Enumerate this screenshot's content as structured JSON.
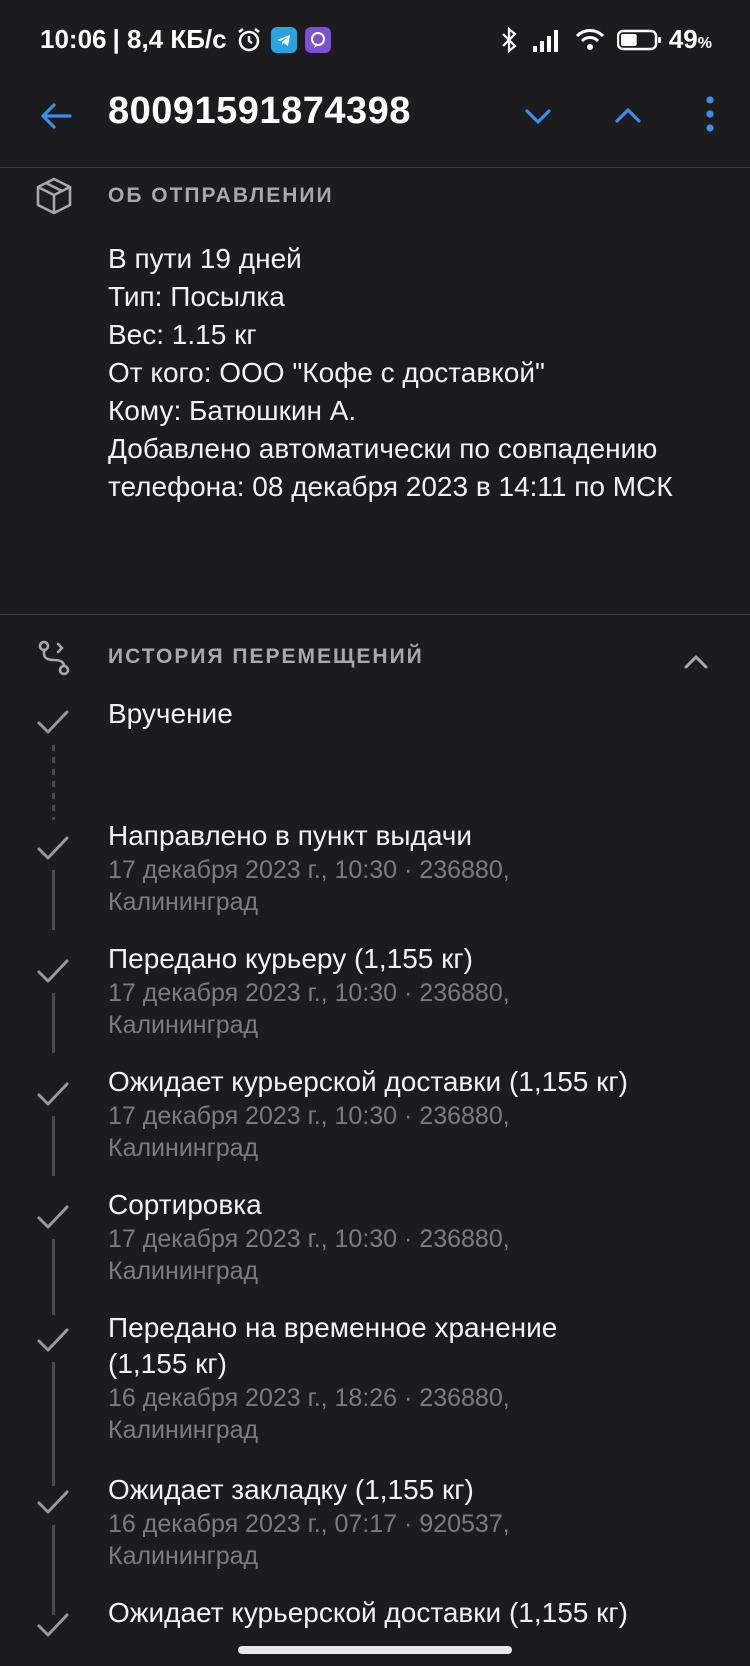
{
  "statusbar": {
    "time": "10:06",
    "speed": "| 8,4 КБ/с",
    "battery_pct": "49",
    "battery_unit": "%",
    "battery_level": 0.49
  },
  "appbar": {
    "title": "80091591874398",
    "icons": [
      "arrow-left-icon",
      "chevron-down-icon",
      "chevron-up-icon",
      "more-vert-icon"
    ],
    "accent_color": "#3b8fe8"
  },
  "about": {
    "header": "ОБ ОТПРАВЛЕНИИ",
    "icon": "package-icon",
    "lines": [
      "В пути 19 дней",
      "Тип: Посылка",
      "Вес: 1.15 кг",
      "От кого: ООО \"Кофе с доставкой\"",
      "Кому: Батюшкин А.",
      "Добавлено автоматически по совпадению телефона: 08 декабря 2023 в 14:11 по МСК"
    ]
  },
  "history": {
    "header": "ИСТОРИЯ ПЕРЕМЕЩЕНИЙ",
    "icon": "route-icon",
    "events": [
      {
        "title": "Вручение",
        "meta": ""
      },
      {
        "title": "Направлено в пункт выдачи",
        "meta": "17 декабря 2023 г., 10:30 · 236880, Калининград"
      },
      {
        "title": "Передано курьеру (1,155 кг)",
        "meta": "17 декабря 2023 г., 10:30 · 236880, Калининград"
      },
      {
        "title": "Ожидает курьерской доставки (1,155 кг)",
        "meta": "17 декабря 2023 г., 10:30 · 236880, Калининград"
      },
      {
        "title": "Сортировка",
        "meta": "17 декабря 2023 г., 10:30 · 236880, Калининград"
      },
      {
        "title": "Передано на временное хранение (1,155 кг)",
        "meta": "16 декабря 2023 г., 18:26 · 236880, Калининград"
      },
      {
        "title": "Ожидает закладку (1,155 кг)",
        "meta": "16 декабря 2023 г., 07:17 · 920537, Калининград"
      },
      {
        "title": "Ожидает курьерской доставки (1,155 кг)",
        "meta": ""
      }
    ]
  }
}
